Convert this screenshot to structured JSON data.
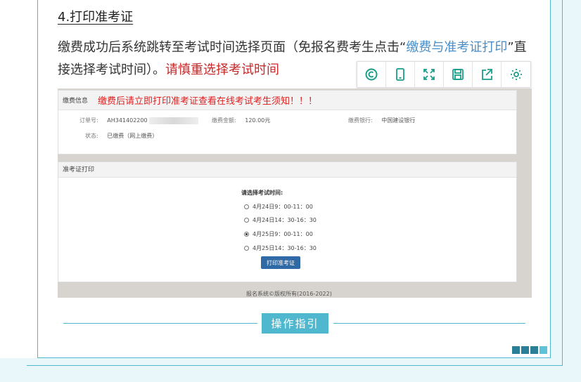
{
  "article": {
    "heading": "4.打印准考证",
    "para_part1": "缴费成功后系统跳转至考试时间选择页面（免报名费考生点击“",
    "para_link": "缴费与准考证打印",
    "para_part2": "”直接选择考试时间）。",
    "para_red": "请慎重选择考试时间"
  },
  "toolbar": {
    "icons": [
      "search-circle-icon",
      "phone-icon",
      "expand-icon",
      "save-icon",
      "share-icon",
      "settings-gear-icon"
    ]
  },
  "screenshot": {
    "pay_title": "缴费信息",
    "pay_warning": "缴费后请立即打印准考证查看在线考试考生须知！！！",
    "order_label": "订单号:",
    "order_value": "AH341402200",
    "amount_label": "缴费金额:",
    "amount_value": "120.00元",
    "bank_label": "缴费银行:",
    "bank_value": "中国建设银行",
    "status_label": "状态:",
    "status_value": "已缴费（网上缴费）",
    "admit_title": "准考证打印",
    "prompt": "请选择考试时间:",
    "options": [
      {
        "label": "4月24日9：00-11：00",
        "selected": false
      },
      {
        "label": "4月24日14：30-16：30",
        "selected": false
      },
      {
        "label": "4月25日9：00-11：00",
        "selected": true
      },
      {
        "label": "4月25日14：30-16：30",
        "selected": false
      }
    ],
    "print_button": "打印准考证",
    "copyright": "报名系统©版权所有(2016-2022)"
  },
  "guide": {
    "button_label": "操作指引"
  },
  "colors": {
    "accent": "#4fb8cf",
    "link": "#4a8ec8",
    "warning": "#c62828",
    "squares": [
      "#2a7f96",
      "#2a7f96",
      "#2a7f96",
      "#5fc3d8"
    ]
  }
}
